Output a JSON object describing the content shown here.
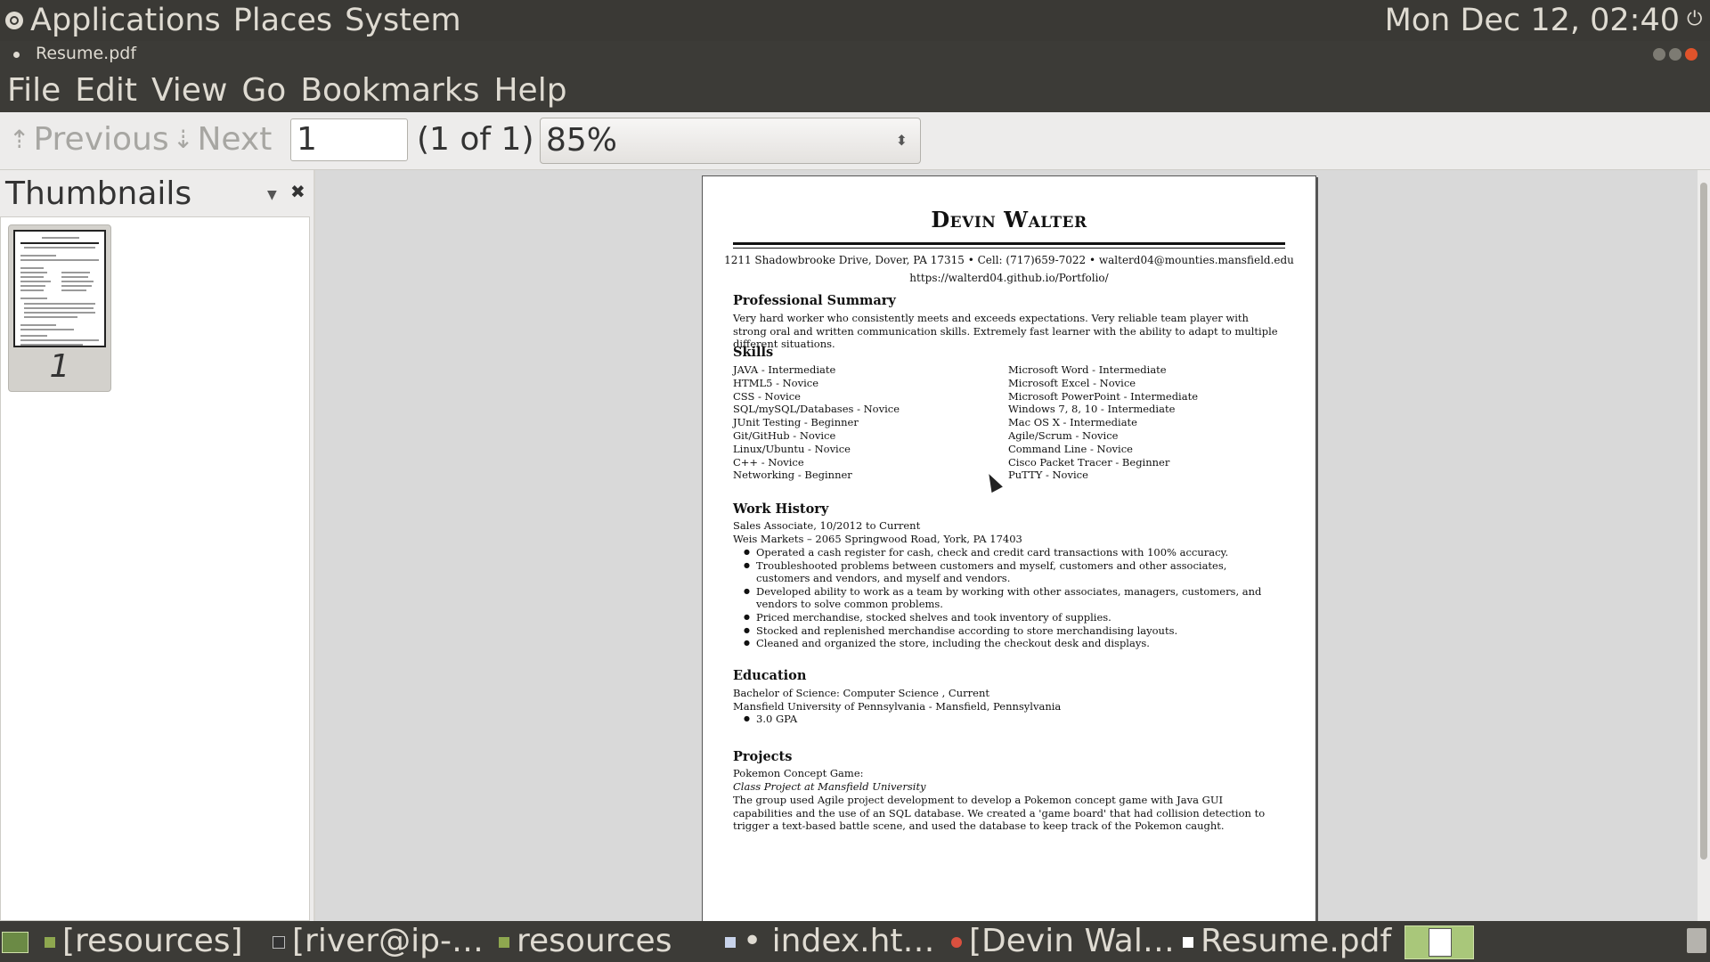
{
  "topbar": {
    "menus": [
      "Applications",
      "Places",
      "System"
    ],
    "clock": "Mon Dec 12, 02:40"
  },
  "window": {
    "title": "Resume.pdf"
  },
  "menubar": [
    "File",
    "Edit",
    "View",
    "Go",
    "Bookmarks",
    "Help"
  ],
  "toolbar": {
    "previous": "Previous",
    "next": "Next",
    "page_value": "1",
    "page_count": "(1 of 1)",
    "zoom": "85%"
  },
  "sidebar": {
    "title": "Thumbnails",
    "thumbs": [
      {
        "label": "1"
      }
    ]
  },
  "document": {
    "name": "Devin Walter",
    "contact_line1": "1211 Shadowbrooke Drive, Dover, PA 17315 • Cell: (717)659-7022 • walterd04@mounties.mansfield.edu",
    "contact_line2": "https://walterd04.github.io/Portfolio/",
    "summary_heading": "Professional Summary",
    "summary": "Very hard worker who consistently meets and exceeds expectations.  Very reliable team player with strong oral and written communication skills.  Extremely fast learner with the ability to adapt to multiple different  situations.",
    "skills_heading": "Skills",
    "skills_left": [
      "JAVA - Intermediate",
      "HTML5 - Novice",
      "CSS - Novice",
      "SQL/mySQL/Databases - Novice",
      "JUnit Testing - Beginner",
      "Git/GitHub - Novice",
      "Linux/Ubuntu - Novice",
      "C++ - Novice",
      "Networking - Beginner"
    ],
    "skills_right": [
      "Microsoft Word - Intermediate",
      "Microsoft Excel - Novice",
      "Microsoft PowerPoint - Intermediate",
      "Windows 7, 8, 10 - Intermediate",
      "Mac OS X - Intermediate",
      "Agile/Scrum - Novice",
      "Command Line - Novice",
      "Cisco Packet Tracer - Beginner",
      "PuTTY - Novice"
    ],
    "work_heading": "Work History",
    "work_title": "Sales Associate, 10/2012 to Current",
    "work_place": "Weis Markets – 2065 Springwood Road, York, PA 17403",
    "work_bullets": [
      "Operated a cash register for cash, check and credit card transactions with 100% accuracy.",
      "Troubleshooted problems between customers and myself,  customers and other associates, customers and vendors, and myself and vendors.",
      "Developed ability to work as a team by working with other associates, managers, customers, and vendors to solve common problems.",
      "Priced merchandise, stocked shelves and took inventory of supplies.",
      "Stocked and replenished merchandise according to store merchandising layouts.",
      "Cleaned and organized the store, including the checkout desk and displays."
    ],
    "edu_heading": "Education",
    "edu_degree": "Bachelor of Science: Computer Science , Current",
    "edu_school": "Mansfield University of Pennsylvania - Mansfield, Pennsylvania",
    "edu_bullets": [
      "3.0 GPA"
    ],
    "projects_heading": "Projects",
    "project_name": "Pokemon Concept Game:",
    "project_sub": "Class Project at Mansfield University",
    "project_desc": "The group used Agile project development  to develop a Pokemon concept game with Java GUI capabilities and the use of an SQL database.  We created a 'game board' that had collision detection to trigger a text-based battle scene, and used the database to keep track of the Pokemon caught."
  },
  "taskbar": {
    "tasks": [
      "[resources]",
      "[river@ip-…",
      "resources",
      "• index.ht…",
      "[Devin Wal…",
      "Resume.pdf"
    ]
  }
}
